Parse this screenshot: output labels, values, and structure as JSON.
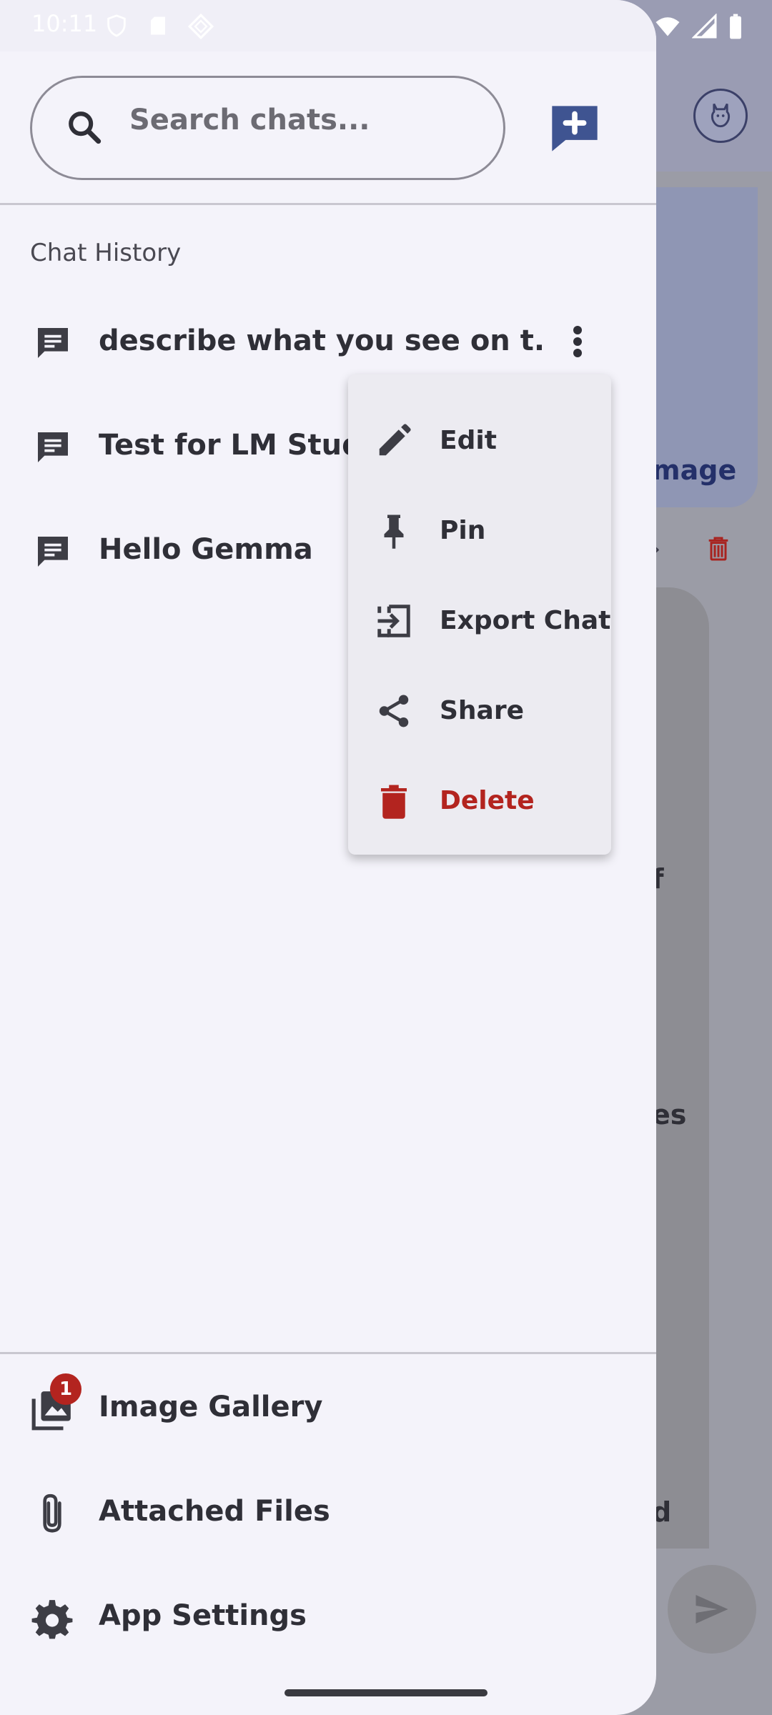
{
  "status_bar": {
    "time": "10:11"
  },
  "search": {
    "placeholder": "Search chats..."
  },
  "new_chat": {
    "icon": "add-chat-icon",
    "accent": "#3f5491"
  },
  "chat_history": {
    "label": "Chat History",
    "items": [
      {
        "title": "describe what you see on t..."
      },
      {
        "title": "Test for LM Studio"
      },
      {
        "title": "Hello Gemma"
      }
    ]
  },
  "context_menu": {
    "items": [
      {
        "label": "Edit",
        "icon": "pencil-icon"
      },
      {
        "label": "Pin",
        "icon": "pin-icon"
      },
      {
        "label": "Export Chat",
        "icon": "export-icon"
      },
      {
        "label": "Share",
        "icon": "share-icon"
      },
      {
        "label": "Delete",
        "icon": "trash-icon",
        "color": "#b3241f"
      }
    ]
  },
  "bottom_nav": {
    "items": [
      {
        "label": "Image Gallery",
        "icon": "image-gallery-icon",
        "badge": "1"
      },
      {
        "label": "Attached Files",
        "icon": "paperclip-icon"
      },
      {
        "label": "App Settings",
        "icon": "gear-icon"
      }
    ]
  },
  "background": {
    "card_text": "mage",
    "frag_1": "f",
    "frag_2": "es",
    "frag_3": "d"
  }
}
